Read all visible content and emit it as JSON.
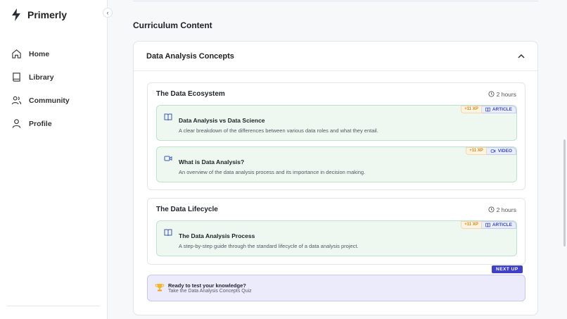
{
  "app": {
    "name": "Primerly",
    "accent": "#3f3fc8"
  },
  "sidebar": {
    "collapse_icon": "chevron-left-icon",
    "items": [
      {
        "label": "Home",
        "icon": "home-icon"
      },
      {
        "label": "Library",
        "icon": "book-icon"
      },
      {
        "label": "Community",
        "icon": "users-icon"
      },
      {
        "label": "Profile",
        "icon": "user-icon"
      }
    ]
  },
  "main": {
    "section_title": "Curriculum Content",
    "accordion": {
      "title": "Data Analysis Concepts",
      "expanded": true,
      "modules": [
        {
          "title": "The Data Ecosystem",
          "duration": "2 hours",
          "lessons": [
            {
              "title": "Data Analysis vs Data Science",
              "description": "A clear breakdown of the differences between various data roles and what they entail.",
              "xp": "+11 XP",
              "type": "ARTICLE",
              "icon": "book-open-icon"
            },
            {
              "title": "What is Data Analysis?",
              "description": "An overview of the data analysis process and its importance in decision making.",
              "xp": "+11 XP",
              "type": "VIDEO",
              "icon": "video-icon"
            }
          ]
        },
        {
          "title": "The Data Lifecycle",
          "duration": "2 hours",
          "lessons": [
            {
              "title": "The Data Analysis Process",
              "description": "A step-by-step guide through the standard lifecycle of a data analysis project.",
              "xp": "+11 XP",
              "type": "ARTICLE",
              "icon": "book-open-icon"
            }
          ]
        }
      ],
      "next_up_label": "NEXT UP",
      "quiz": {
        "title": "Ready to test your knowledge?",
        "subtitle": "Take the Data Analysis Concepts Quiz",
        "icon": "trophy-icon"
      }
    }
  }
}
